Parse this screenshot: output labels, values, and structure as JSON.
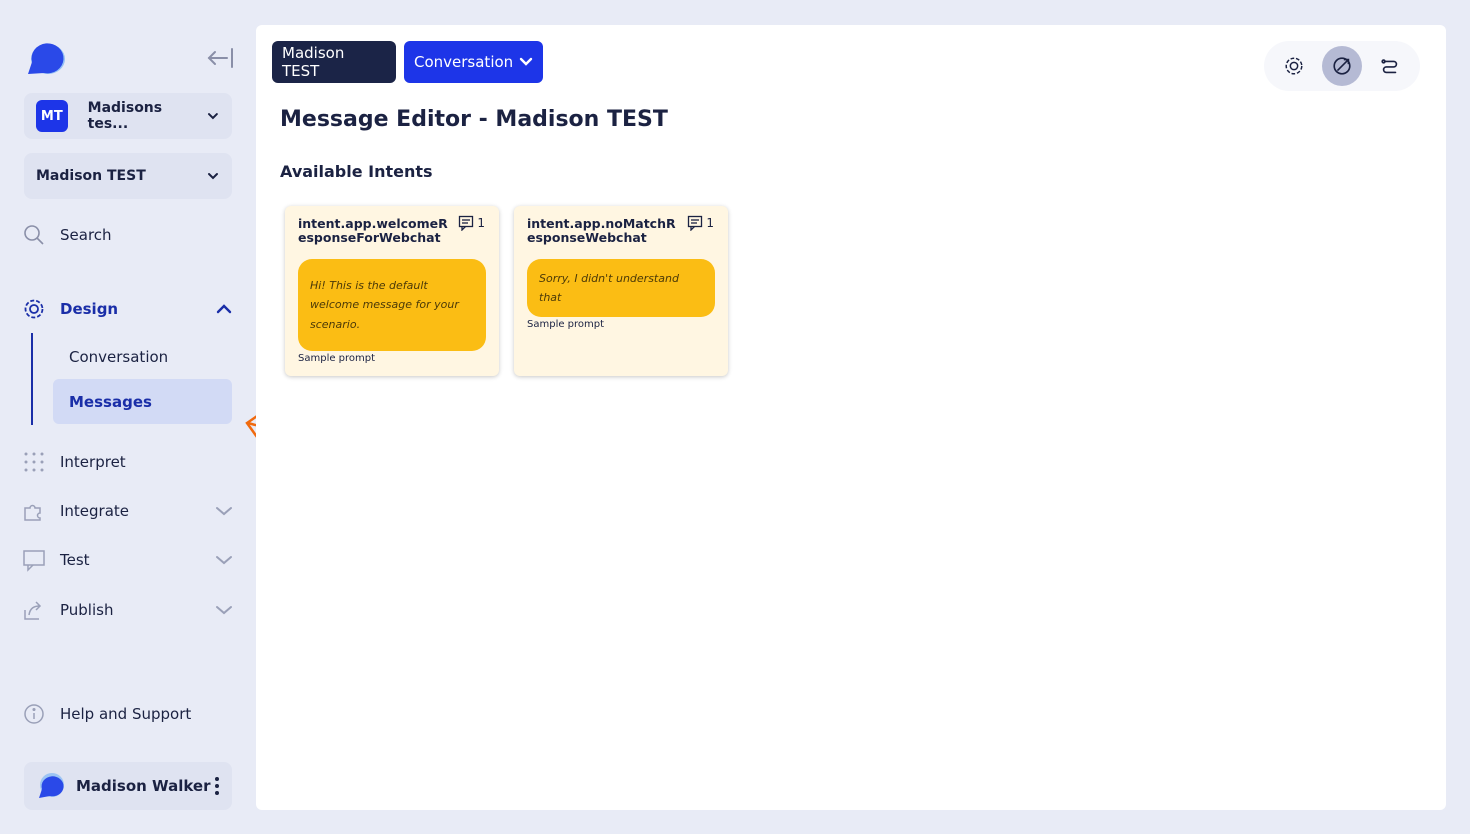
{
  "sidebar": {
    "workspace": {
      "initials": "MT",
      "name": "Madisons tes..."
    },
    "project": {
      "name": "Madison TEST"
    },
    "nav": {
      "search": "Search",
      "design": "Design",
      "conversation": "Conversation",
      "messages": "Messages",
      "interpret": "Interpret",
      "integrate": "Integrate",
      "test": "Test",
      "publish": "Publish",
      "help": "Help and Support"
    },
    "user": {
      "name": "Madison Walker"
    }
  },
  "header": {
    "project_button": "Madison TEST",
    "view_dropdown": "Conversation"
  },
  "main": {
    "title": "Message Editor - Madison TEST",
    "section_title": "Available Intents",
    "intents": [
      {
        "name": "intent.app.welcomeResponseForWebchat",
        "count": "1",
        "message": "Hi! This is the default welcome message for your scenario.",
        "prompt_label": "Sample prompt"
      },
      {
        "name": "intent.app.noMatchResponseWebchat",
        "count": "1",
        "message": "Sorry, I didn't understand that",
        "prompt_label": "Sample prompt"
      }
    ]
  },
  "colors": {
    "accent": "#1d35e8",
    "dark_navy": "#1b2447",
    "bubble": "#fbbd14",
    "card_bg": "#fff6e2",
    "annotation_arrow": "#f06a0f"
  },
  "icons": {
    "logo": "chat-bubble-logo",
    "collapse": "collapse-sidebar-icon",
    "search": "search-icon",
    "design": "design-gear-icon",
    "interpret": "dots-grid-icon",
    "integrate": "puzzle-icon",
    "test": "chat-window-icon",
    "publish": "share-icon",
    "help": "info-icon",
    "toolbar": [
      "design-gear-icon",
      "edit-compass-icon",
      "flow-icon"
    ]
  }
}
